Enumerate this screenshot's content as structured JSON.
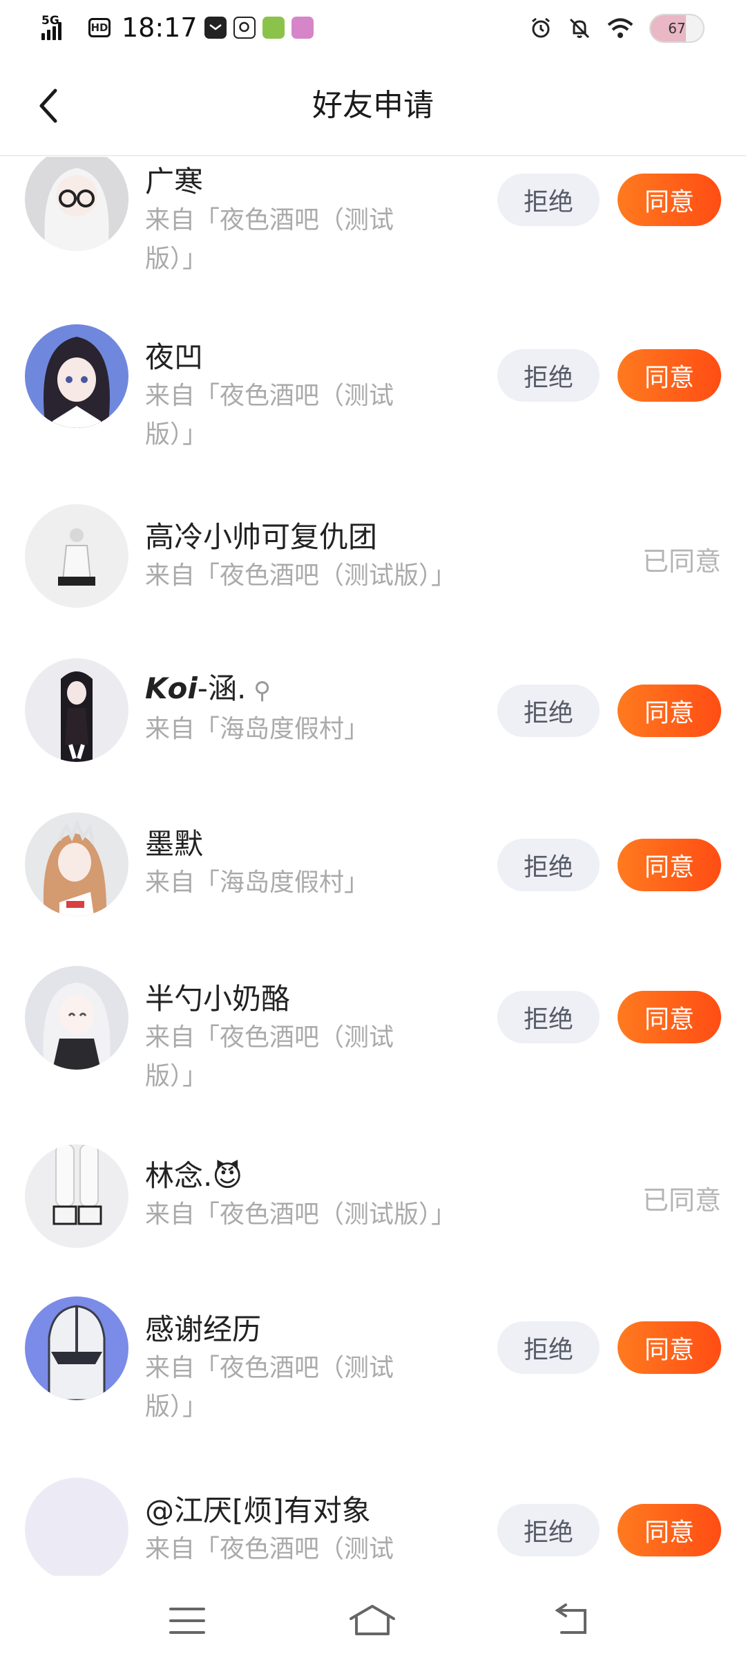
{
  "status_bar": {
    "network": "5G",
    "hd": "HD",
    "time": "18:17",
    "battery": 67,
    "icons": [
      "signal-icon",
      "hd-icon",
      "mail-icon",
      "qq-icon",
      "app-icon",
      "app-icon",
      "alarm-icon",
      "mute-icon",
      "wifi-icon",
      "battery-icon"
    ]
  },
  "header": {
    "title": "好友申请",
    "back_icon": "chevron-left-icon"
  },
  "colors": {
    "accent": "#ff5a1a",
    "reject_bg": "#eef0f5",
    "muted": "#aaaaaa"
  },
  "requests": [
    {
      "name": "广寒",
      "source_line1": "来自「夜色酒吧（测试",
      "source_line2": "版）」",
      "status": "pending",
      "reject_label": "拒绝",
      "agree_label": "同意"
    },
    {
      "name": "夜凹",
      "source_line1": "来自「夜色酒吧（测试",
      "source_line2": "版）」",
      "status": "pending",
      "reject_label": "拒绝",
      "agree_label": "同意"
    },
    {
      "name": "高冷小帅可复仇团",
      "source_line1": "来自「夜色酒吧（测试版）」",
      "status": "agreed",
      "status_label": "已同意"
    },
    {
      "name": "𝙆𝙤𝙞-涵.",
      "source_line1": "来自「海岛度假村」",
      "status": "pending",
      "reject_label": "拒绝",
      "agree_label": "同意"
    },
    {
      "name": "墨默",
      "source_line1": "来自「海岛度假村」",
      "status": "pending",
      "reject_label": "拒绝",
      "agree_label": "同意"
    },
    {
      "name": "半勺小奶酪",
      "source_line1": "来自「夜色酒吧（测试",
      "source_line2": "版）」",
      "status": "pending",
      "reject_label": "拒绝",
      "agree_label": "同意"
    },
    {
      "name": "林念.😈",
      "source_line1": "来自「夜色酒吧（测试版）」",
      "status": "agreed",
      "status_label": "已同意"
    },
    {
      "name": "感谢经历",
      "source_line1": "来自「夜色酒吧（测试",
      "source_line2": "版）」",
      "status": "pending",
      "reject_label": "拒绝",
      "agree_label": "同意"
    },
    {
      "name": "@江厌[烦]有对象",
      "source_line1": "来自「夜色酒吧（测试",
      "status": "pending",
      "reject_label": "拒绝",
      "agree_label": "同意"
    }
  ],
  "nav": {
    "icons": [
      "menu-icon",
      "home-icon",
      "back-icon"
    ]
  }
}
